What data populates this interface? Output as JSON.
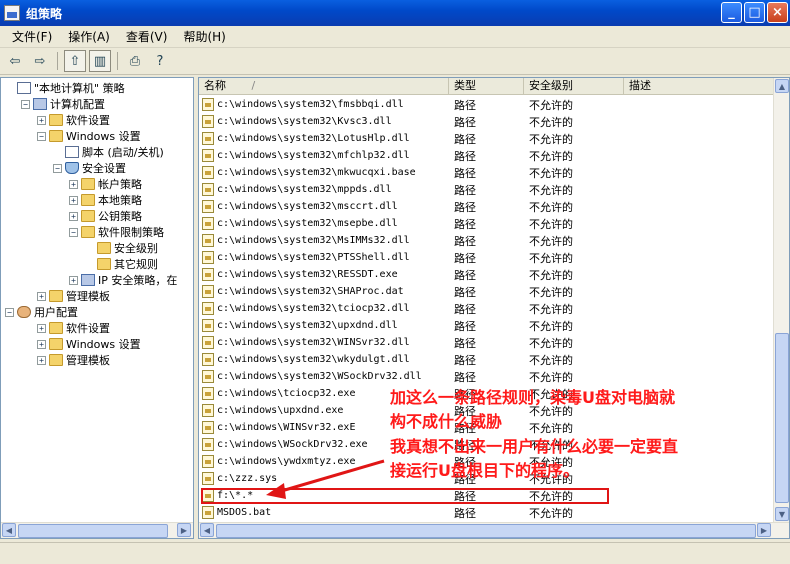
{
  "window": {
    "title": "组策略",
    "min": "_",
    "max": "□",
    "close": "×"
  },
  "menu": [
    "文件(F)",
    "操作(A)",
    "查看(V)",
    "帮助(H)"
  ],
  "toolbar": {
    "back": "⇦",
    "forward": "⇨",
    "up": "⇧",
    "tree": "▥",
    "export": "⎙",
    "help": "?"
  },
  "tree": [
    {
      "label": "\"本地计算机\" 策略",
      "icon": "doc-icon",
      "exp": ""
    },
    {
      "label": "计算机配置",
      "icon": "computer-icon",
      "exp": "−"
    },
    {
      "label": "软件设置",
      "icon": "folder-icon",
      "exp": "+"
    },
    {
      "label": "Windows 设置",
      "icon": "folder-icon",
      "exp": "−"
    },
    {
      "label": "脚本 (启动/关机)",
      "icon": "doc-icon",
      "exp": ""
    },
    {
      "label": "安全设置",
      "icon": "shield-icon",
      "exp": "−"
    },
    {
      "label": "帐户策略",
      "icon": "folder-icon",
      "exp": "+"
    },
    {
      "label": "本地策略",
      "icon": "folder-icon",
      "exp": "+"
    },
    {
      "label": "公钥策略",
      "icon": "folder-icon",
      "exp": "+"
    },
    {
      "label": "软件限制策略",
      "icon": "folder-icon",
      "exp": "−"
    },
    {
      "label": "安全级别",
      "icon": "folder-icon",
      "exp": ""
    },
    {
      "label": "其它规则",
      "icon": "folder-icon",
      "exp": ""
    },
    {
      "label": "IP 安全策略，在",
      "icon": "computer-icon",
      "exp": "+"
    },
    {
      "label": "管理模板",
      "icon": "folder-icon",
      "exp": "+"
    },
    {
      "label": "用户配置",
      "icon": "user-icon",
      "exp": "−"
    },
    {
      "label": "软件设置",
      "icon": "folder-icon",
      "exp": "+"
    },
    {
      "label": "Windows 设置",
      "icon": "folder-icon",
      "exp": "+"
    },
    {
      "label": "管理模板",
      "icon": "folder-icon",
      "exp": "+"
    }
  ],
  "columns": {
    "name": "名称",
    "sort": "/",
    "type": "类型",
    "level": "安全级别",
    "desc": "描述"
  },
  "rows": [
    {
      "name": "c:\\windows\\system32\\fmsbbqi.dll",
      "type": "路径",
      "level": "不允许的"
    },
    {
      "name": "c:\\windows\\system32\\Kvsc3.dll",
      "type": "路径",
      "level": "不允许的"
    },
    {
      "name": "c:\\windows\\system32\\LotusHlp.dll",
      "type": "路径",
      "level": "不允许的"
    },
    {
      "name": "c:\\windows\\system32\\mfchlp32.dll",
      "type": "路径",
      "level": "不允许的"
    },
    {
      "name": "c:\\windows\\system32\\mkwucqxi.base",
      "type": "路径",
      "level": "不允许的"
    },
    {
      "name": "c:\\windows\\system32\\mppds.dll",
      "type": "路径",
      "level": "不允许的"
    },
    {
      "name": "c:\\windows\\system32\\msccrt.dll",
      "type": "路径",
      "level": "不允许的"
    },
    {
      "name": "c:\\windows\\system32\\msepbe.dll",
      "type": "路径",
      "level": "不允许的"
    },
    {
      "name": "c:\\windows\\system32\\MsIMMs32.dll",
      "type": "路径",
      "level": "不允许的"
    },
    {
      "name": "c:\\windows\\system32\\PTSShell.dll",
      "type": "路径",
      "level": "不允许的"
    },
    {
      "name": "c:\\windows\\system32\\RESSDT.exe",
      "type": "路径",
      "level": "不允许的"
    },
    {
      "name": "c:\\windows\\system32\\SHAProc.dat",
      "type": "路径",
      "level": "不允许的"
    },
    {
      "name": "c:\\windows\\system32\\tciocp32.dll",
      "type": "路径",
      "level": "不允许的"
    },
    {
      "name": "c:\\windows\\system32\\upxdnd.dll",
      "type": "路径",
      "level": "不允许的"
    },
    {
      "name": "c:\\windows\\system32\\WINSvr32.dll",
      "type": "路径",
      "level": "不允许的"
    },
    {
      "name": "c:\\windows\\system32\\wkydulgt.dll",
      "type": "路径",
      "level": "不允许的"
    },
    {
      "name": "c:\\windows\\system32\\WSockDrv32.dll",
      "type": "路径",
      "level": "不允许的"
    },
    {
      "name": "c:\\windows\\tciocp32.exe",
      "type": "路径",
      "level": "不允许的"
    },
    {
      "name": "c:\\windows\\upxdnd.exe",
      "type": "路径",
      "level": "不允许的"
    },
    {
      "name": "c:\\windows\\WINSvr32.exE",
      "type": "路径",
      "level": "不允许的"
    },
    {
      "name": "c:\\windows\\WSockDrv32.exe",
      "type": "路径",
      "level": "不允许的"
    },
    {
      "name": "c:\\windows\\ywdxmtyz.exe",
      "type": "路径",
      "level": "不允许的"
    },
    {
      "name": "c:\\zzz.sys",
      "type": "路径",
      "level": "不允许的"
    },
    {
      "name": "f:\\*.*",
      "type": "路径",
      "level": "不允许的"
    },
    {
      "name": "MSDOS.bat",
      "type": "路径",
      "level": "不允许的"
    }
  ],
  "annotation": {
    "line1": "加这么一条路径规则，染毒U盘对电脑就",
    "line2": "构不成什么威胁",
    "line3": "我真想不出来一用户有什么必要一定要直",
    "line4": "接运行U盘根目下的程序。"
  },
  "colors": {
    "annotation": "#ff1a1a",
    "titlebar": "#0a5fe0"
  }
}
